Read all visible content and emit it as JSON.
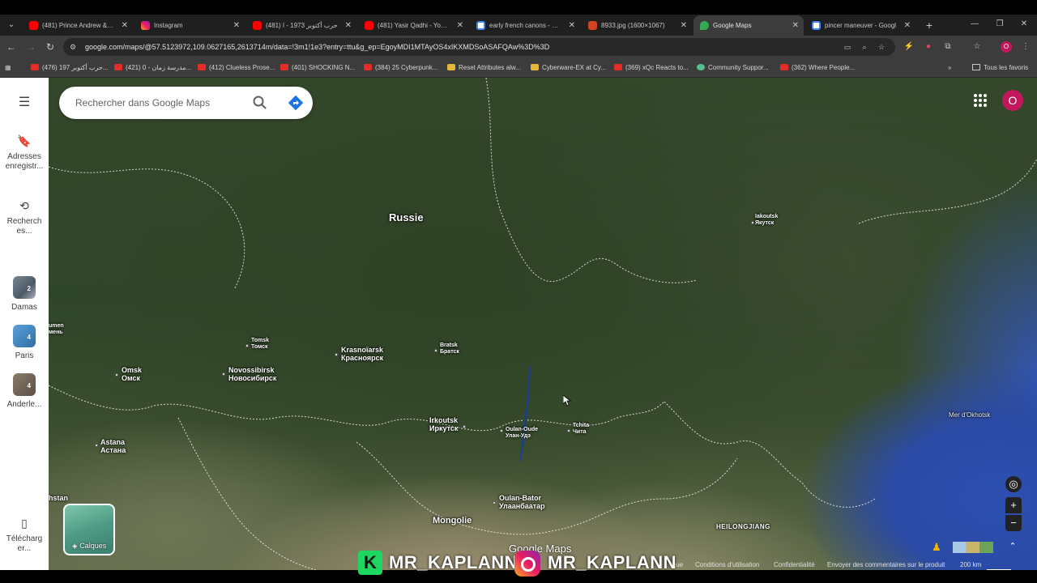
{
  "tabs": [
    {
      "title": "(481) Prince Andrew & the",
      "favicon": "youtube",
      "active": false
    },
    {
      "title": "Instagram",
      "favicon": "instagram",
      "active": false
    },
    {
      "title": "(481) حرب أكتوبر 1973 - ا",
      "favicon": "youtube",
      "active": false
    },
    {
      "title": "(481) Yasir Qadhi - YouTub",
      "favicon": "youtube",
      "active": false
    },
    {
      "title": "early french canons - Goo",
      "favicon": "google",
      "active": false
    },
    {
      "title": "8933.jpg (1600×1067)",
      "favicon": "image",
      "active": false
    },
    {
      "title": "Google Maps",
      "favicon": "maps",
      "active": true
    },
    {
      "title": "pincer maneuver - Googl",
      "favicon": "google",
      "active": false
    }
  ],
  "address_bar": {
    "url": "google.com/maps/@57.5123972,109.0627165,2613714m/data=!3m1!1e3?entry=ttu&g_ep=EgoyMDI1MTAyOS4xIKXMDSoASAFQAw%3D%3D"
  },
  "bookmarks": [
    {
      "label": "(476) حرب أكتوبر 197...",
      "icon": "youtube"
    },
    {
      "label": "(421) مدرسة زمان - 0...",
      "icon": "youtube"
    },
    {
      "label": "(412) Clueless Prose...",
      "icon": "youtube"
    },
    {
      "label": "(401) SHOCKING N...",
      "icon": "youtube"
    },
    {
      "label": "(384) 25 Cyberpunk...",
      "icon": "youtube"
    },
    {
      "label": "Reset Attributes alw...",
      "icon": "game"
    },
    {
      "label": "Cyberware-EX at Cy...",
      "icon": "game"
    },
    {
      "label": "(369) xQc Reacts to...",
      "icon": "youtube"
    },
    {
      "label": "Community Suppor...",
      "icon": "support"
    },
    {
      "label": "(362) Where People...",
      "icon": "youtube"
    }
  ],
  "all_bookmarks_label": "Tous les favoris",
  "profile_initial": "O",
  "sidebar": {
    "menu_icon": "hamburger-icon",
    "items": [
      {
        "label": "Adresses enregistr...",
        "icon": "bookmark-icon"
      },
      {
        "label": "Recherch es...",
        "icon": "history-icon"
      },
      {
        "label": "Damas",
        "badge": "2"
      },
      {
        "label": "Paris",
        "badge": "4"
      },
      {
        "label": "Anderle...",
        "badge": "4"
      },
      {
        "label": "Télécharg er...",
        "icon": "phone-icon"
      }
    ]
  },
  "search": {
    "placeholder": "Rechercher dans Google Maps"
  },
  "map": {
    "view": "satellite",
    "labels": {
      "russia": "Russie",
      "mongolia": "Mongolie",
      "okhotsk": "Mer d'Okhotsk",
      "heilongjiang": "HEILONGJIANG",
      "iakoutsk": "Iakoutsk",
      "iakoutsk_ru": "Якутск",
      "tomsk": "Tomsk",
      "tomsk_ru": "Томск",
      "krasnoiarsk": "Krasnoïarsk",
      "krasnoiarsk_ru": "Красноярск",
      "bratsk": "Bratsk",
      "bratsk_ru": "Братск",
      "omsk": "Omsk",
      "omsk_ru": "Омск",
      "novosibirsk": "Novossibirsk",
      "novosibirsk_ru": "Новосибирск",
      "irkoutsk": "Irkoutsk",
      "irkoutsk_ru": "Иркутск",
      "oulan_oude": "Oulan-Oude",
      "oulan_oude_ru": "Улан-Удэ",
      "tchita": "Tchita",
      "tchita_ru": "Чита",
      "astana": "Astana",
      "astana_ru": "Астана",
      "oulan_bator": "Oulan-Bator",
      "oulan_bator_ru": "Улаанбаатар",
      "tioumen_partial": "umen",
      "tioumen_ru_partial": "мень",
      "kazakhstan_partial": "hstan"
    }
  },
  "layers_label": "Calques",
  "footer": {
    "google_maps_mark": "Google Maps",
    "partial_label": "ique",
    "terms": "Conditions d'utilisation",
    "privacy": "Confidentialité",
    "feedback": "Envoyer des commentaires sur le produit",
    "scale": "200 km"
  },
  "watermark": {
    "text1": "MR_KAPLANN",
    "text2": "MR_KAPLANN"
  },
  "colors": {
    "accent_blue": "#1a73e8",
    "avatar_pink": "#c2185b",
    "active_tab": "#3c3c3c"
  }
}
